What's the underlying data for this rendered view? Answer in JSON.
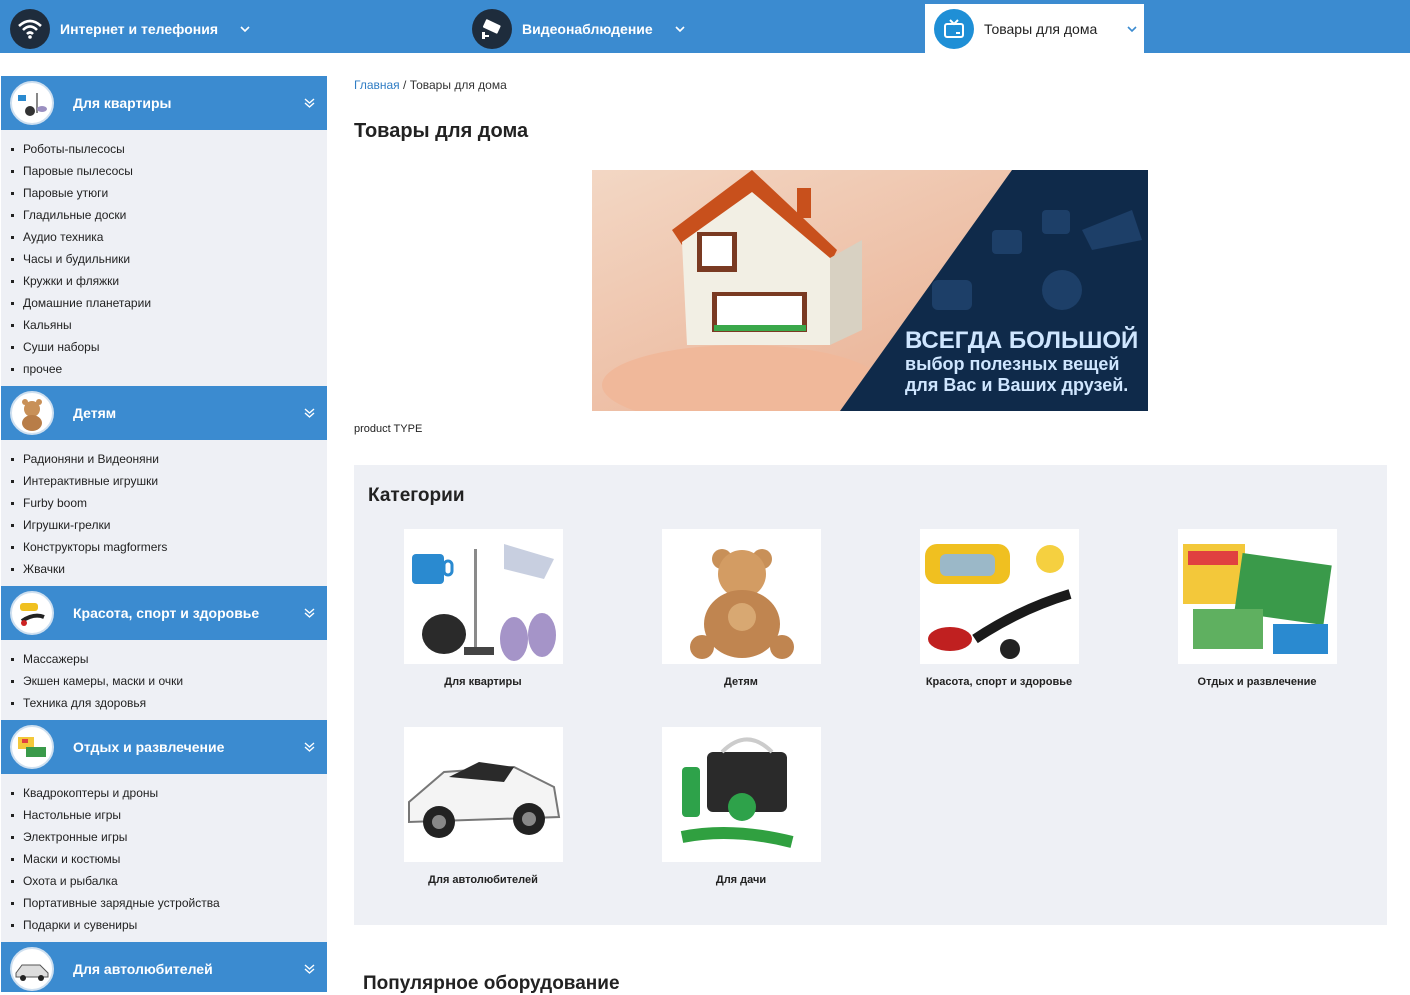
{
  "topnav": {
    "items": [
      {
        "label": "Интернет и телефония",
        "icon": "wifi-icon"
      },
      {
        "label": "Видеонаблюдение",
        "icon": "cctv-camera-icon"
      },
      {
        "label": "Товары для дома",
        "icon": "tv-icon",
        "active": true
      }
    ]
  },
  "sidebar": {
    "sections": [
      {
        "title": "Для квартиры",
        "items": [
          "Роботы-пылесосы",
          "Паровые пылесосы",
          "Паровые утюги",
          "Гладильные доски",
          "Аудио техника",
          "Часы и будильники",
          "Кружки и фляжки",
          "Домашние планетарии",
          "Кальяны",
          "Суши наборы",
          "прочее"
        ]
      },
      {
        "title": "Детям",
        "items": [
          "Радионяни и Видеоняни",
          "Интерактивные игрушки",
          "Furby boom",
          "Игрушки-грелки",
          "Конструкторы magformers",
          "Жвачки"
        ]
      },
      {
        "title": "Красота, спорт и здоровье",
        "items": [
          "Массажеры",
          "Экшен камеры, маски и очки",
          "Техника для здоровья"
        ]
      },
      {
        "title": "Отдых и развлечение",
        "items": [
          "Квадрокоптеры и дроны",
          "Настольные игры",
          "Электронные игры",
          "Маски и костюмы",
          "Охота и рыбалка",
          "Портативные зарядные устройства",
          "Подарки и сувениры"
        ]
      },
      {
        "title": "Для автолюбителей",
        "items": []
      }
    ]
  },
  "breadcrumb": {
    "home": "Главная",
    "separator": " / ",
    "current": "Товары для дома"
  },
  "page_title": "Товары для дома",
  "banner": {
    "line1": "ВСЕГДА БОЛЬШОЙ",
    "line2": "выбор полезных вещей",
    "line3": "для Вас и Ваших друзей."
  },
  "type_label": "product TYPE",
  "categories": {
    "title": "Категории",
    "items": [
      "Для квартиры",
      "Детям",
      "Красота, спорт и здоровье",
      "Отдых и развлечение",
      "Для автолюбителей",
      "Для дачи"
    ]
  },
  "popular_title": "Популярное оборудование",
  "colors": {
    "primary": "#3b8bd0",
    "panel": "#eef0f5",
    "link": "#2f7dc4",
    "banner_dark": "#0f2a4a",
    "banner_text": "#cfe6ff"
  }
}
